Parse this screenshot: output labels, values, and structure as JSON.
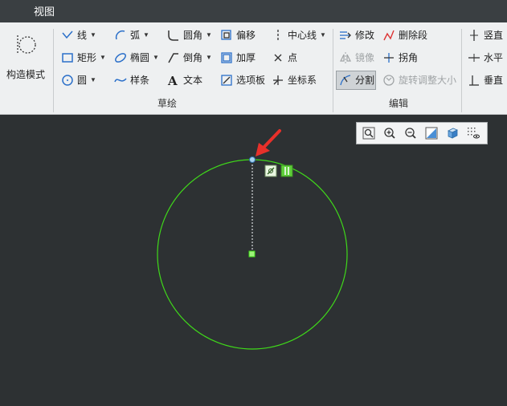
{
  "menubar": {
    "tab_view": "视图"
  },
  "ribbon": {
    "construct_mode": "构造模式",
    "sketch": {
      "group_label": "草绘",
      "line": "线",
      "rectangle": "矩形",
      "circle": "圆",
      "arc": "弧",
      "ellipse": "椭圆",
      "spline": "样条",
      "fillet": "圆角",
      "chamfer": "倒角",
      "text": "文本",
      "offset": "偏移",
      "thicken": "加厚",
      "palette": "选项板",
      "centerline": "中心线",
      "point": "点",
      "coordinate_system": "坐标系"
    },
    "edit": {
      "group_label": "编辑",
      "modify": "修改",
      "mirror": "镜像",
      "divide": "分割",
      "delete_segment": "删除段",
      "corner": "拐角",
      "rotate_resize": "旋转调整大小"
    },
    "constrain": {
      "vertical": "竖直",
      "horizontal": "水平",
      "perpendicular": "垂直"
    }
  },
  "colors": {
    "canvas_bg": "#2d3133",
    "sketch_green": "#3fd91a",
    "arrow_red": "#e8302a"
  }
}
